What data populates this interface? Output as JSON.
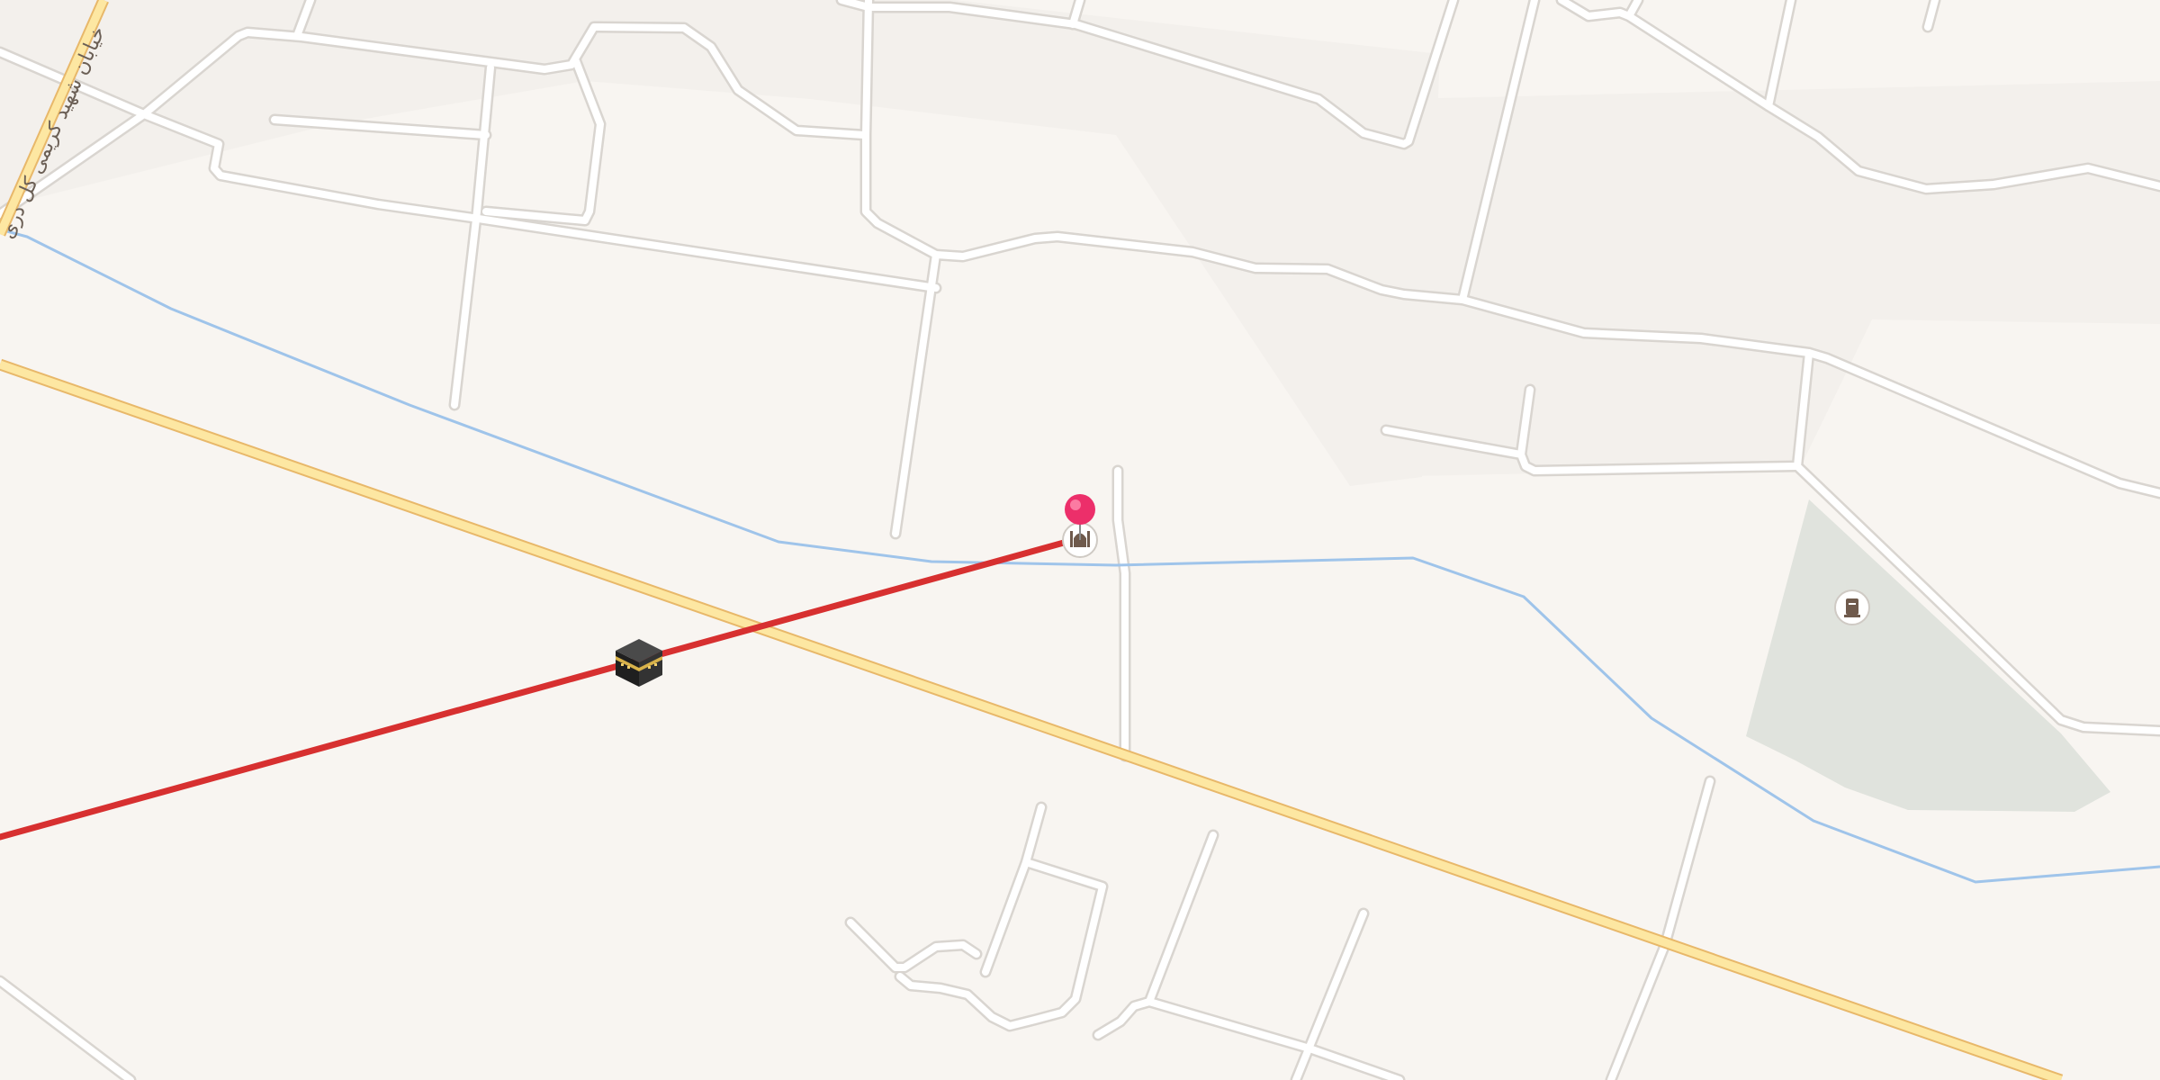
{
  "map": {
    "road_label": "خیابان شهید کریمی کل دری",
    "colors": {
      "background": "#f8f5f1",
      "block_shade": "#f3f0ec",
      "park": "#e0e3dd",
      "minor_road": "#ffffff",
      "road_casing": "#d9d5d0",
      "major_road": "#fde7a2",
      "major_road_casing": "#e8b86a",
      "waterway": "#9fc4ea",
      "qibla_line": "#d73030",
      "pin": "#ec2f6a"
    },
    "markers": [
      {
        "kind": "location-pin",
        "icon": "map-pin-icon"
      },
      {
        "kind": "mosque-poi",
        "icon": "mosque-icon"
      },
      {
        "kind": "cemetery-poi",
        "icon": "tombstone-icon"
      },
      {
        "kind": "kaaba-direction",
        "icon": "kaaba-icon"
      }
    ]
  }
}
